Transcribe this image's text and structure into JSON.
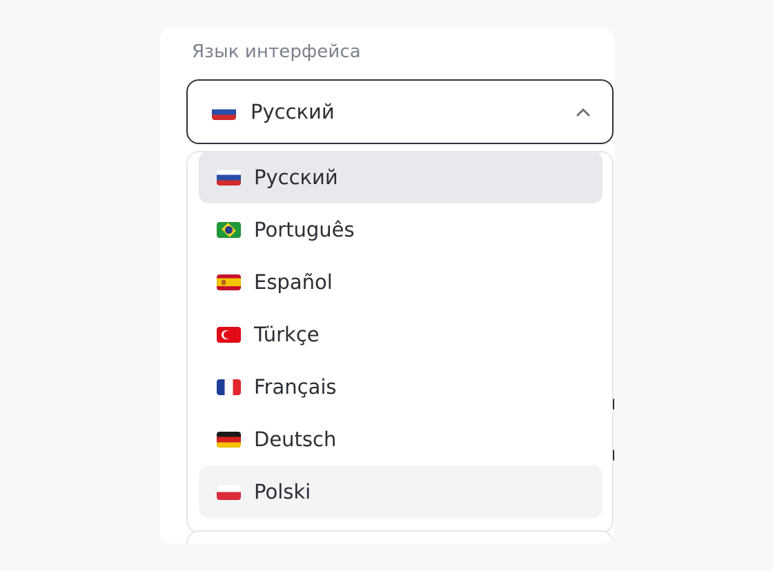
{
  "language_setting": {
    "label": "Язык интерфейса",
    "selected": {
      "label": "Русский",
      "flag_icon": "flag-russia-icon"
    },
    "options": [
      {
        "label": "Русский",
        "flag_icon": "flag-russia-icon",
        "state": "selected"
      },
      {
        "label": "Português",
        "flag_icon": "flag-brazil-icon",
        "state": "default"
      },
      {
        "label": "Español",
        "flag_icon": "flag-spain-icon",
        "state": "default"
      },
      {
        "label": "Türkçe",
        "flag_icon": "flag-turkey-icon",
        "state": "default"
      },
      {
        "label": "Français",
        "flag_icon": "flag-france-icon",
        "state": "default"
      },
      {
        "label": "Deutsch",
        "flag_icon": "flag-germany-icon",
        "state": "default"
      },
      {
        "label": "Polski",
        "flag_icon": "flag-poland-icon",
        "state": "hovered"
      }
    ],
    "dropdown_open": true
  },
  "colors": {
    "page_background": "#f7f8fa",
    "card_background": "#ffffff",
    "select_border": "#2f3238",
    "list_border": "#e5e6ea",
    "selected_option_bg": "#e8e9ed",
    "hovered_option_bg": "#f3f4f6",
    "label_text": "#7c818c",
    "primary_text": "#2b2e34"
  }
}
